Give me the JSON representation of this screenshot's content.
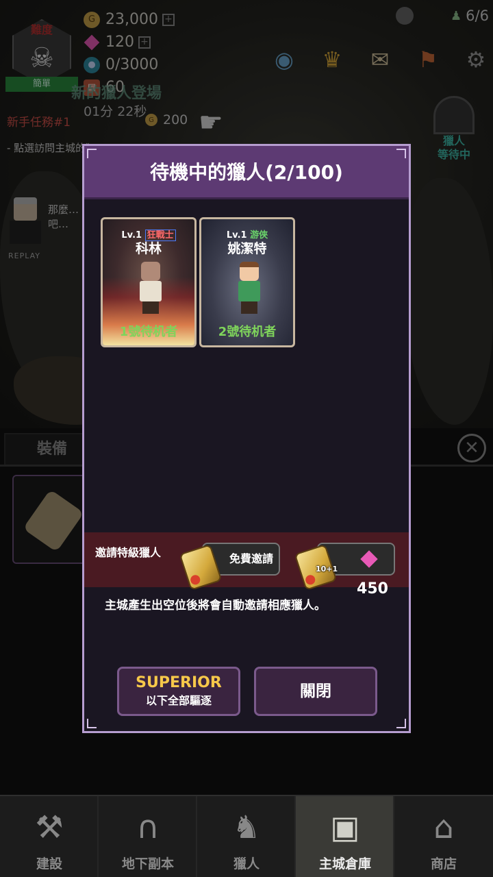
{
  "resources": {
    "gold": "23,000",
    "gems": "120",
    "souls": "0/3000",
    "scrolls": "60",
    "population": "6/6"
  },
  "difficulty": {
    "title": "難度",
    "level": "簡單"
  },
  "event": {
    "title": "新的獵人登場",
    "timer": "01分 22秒"
  },
  "quest": {
    "title": "新手任務#1",
    "reward": "200",
    "description": "- 點選訪問主城的獵人進行對話"
  },
  "npc": {
    "speech_line1": "那麼…",
    "speech_line2": "吧…",
    "replay": "REPLAY"
  },
  "hunter_wait": {
    "line1": "獵人",
    "line2": "等待中"
  },
  "lower_panel": {
    "tab_equipment": "裝備"
  },
  "modal": {
    "title": "待機中的獵人(2/100)",
    "cards": [
      {
        "level": "Lv.1",
        "class": "狂戰士",
        "name": "科林",
        "status": "1號待机者"
      },
      {
        "level": "Lv.1",
        "class": "游俠",
        "name": "姚潔特",
        "status": "2號待机者"
      }
    ],
    "invite": {
      "label": "邀請特級獵人",
      "free_label": "免費邀請",
      "paid_bonus": "10+1",
      "paid_cost": "450"
    },
    "info": "主城產生出空位後將會自動邀請相應獵人。",
    "superior_button": {
      "title": "SUPERIOR",
      "subtitle": "以下全部驅逐"
    },
    "close_button": "關閉"
  },
  "bottom_nav": [
    {
      "label": "建設",
      "icon": "hammer-icon",
      "active": false
    },
    {
      "label": "地下副本",
      "icon": "dungeon-gate-icon",
      "active": false
    },
    {
      "label": "獵人",
      "icon": "hunter-helmet-icon",
      "active": false
    },
    {
      "label": "主城倉庫",
      "icon": "chest-icon",
      "active": true
    },
    {
      "label": "商店",
      "icon": "shop-icon",
      "active": false
    }
  ],
  "colors": {
    "modal_header": "#5d3a73",
    "modal_border": "#b69dd0",
    "invite_bar": "#4a1a22",
    "superior_text": "#f6c84a",
    "waiting_status": "#7fd45b",
    "berserker_class": "#ff6a6a",
    "ranger_class": "#6ad46a"
  }
}
